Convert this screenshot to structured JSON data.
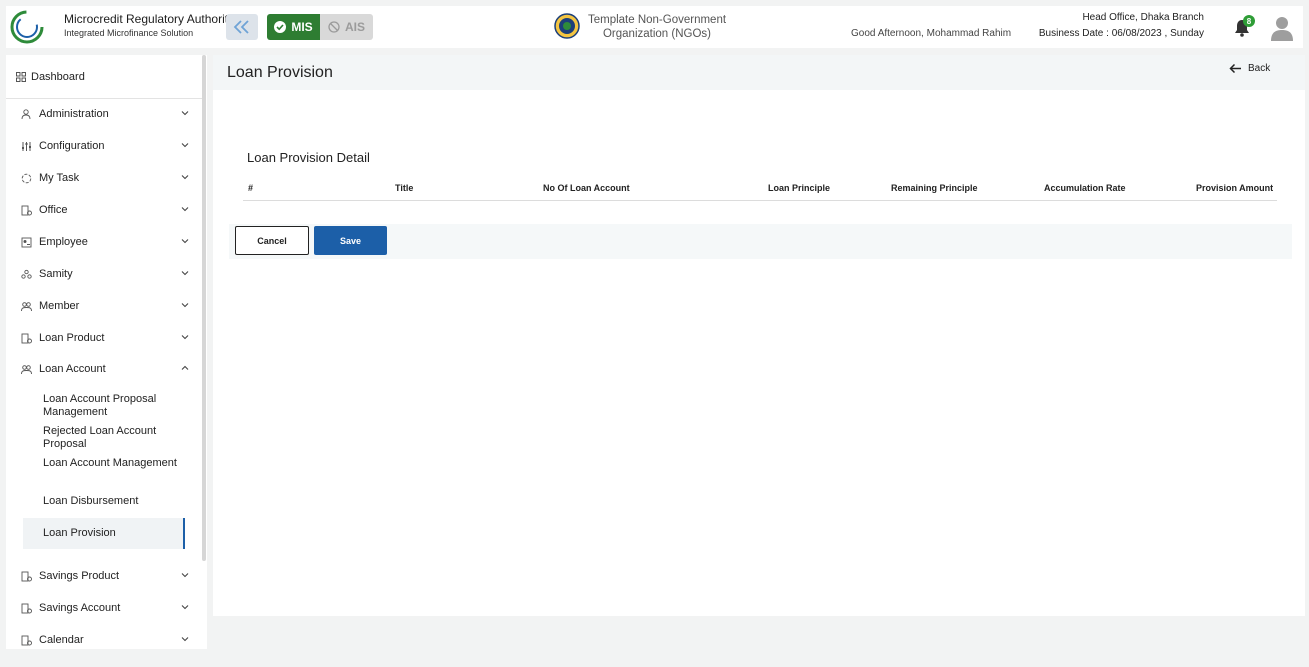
{
  "header": {
    "org_title": "Microcredit Regulatory Authority",
    "org_subtitle": "Integrated Microfinance Solution",
    "logo_text": "Microcredit Regulatory Authority",
    "mode_mis": "MIS",
    "mode_ais": "AIS",
    "ngo_line1": "Template Non-Government",
    "ngo_line2": "Organization (NGOs)",
    "greeting": "Good Afternoon, Mohammad Rahim",
    "branch": "Head Office, Dhaka Branch",
    "business_date": "Business Date : 06/08/2023 , Sunday",
    "notification_count": "8",
    "colors": {
      "brand_green": "#2e7d32",
      "primary_blue": "#1c5fa8"
    }
  },
  "sidebar": {
    "dashboard": "Dashboard",
    "items": [
      {
        "label": "Administration",
        "icon": "admin-icon"
      },
      {
        "label": "Configuration",
        "icon": "sliders-icon"
      },
      {
        "label": "My Task",
        "icon": "task-icon"
      },
      {
        "label": "Office",
        "icon": "office-icon"
      },
      {
        "label": "Employee",
        "icon": "employee-icon"
      },
      {
        "label": "Samity",
        "icon": "samity-icon"
      },
      {
        "label": "Member",
        "icon": "member-icon"
      },
      {
        "label": "Loan Product",
        "icon": "product-icon"
      },
      {
        "label": "Loan Account",
        "icon": "account-icon"
      },
      {
        "label": "Savings Product",
        "icon": "product-icon"
      },
      {
        "label": "Savings Account",
        "icon": "account-icon"
      },
      {
        "label": "Calendar",
        "icon": "calendar-icon"
      }
    ],
    "loan_account_sub": [
      "Loan Account Proposal Management",
      "Rejected Loan Account Proposal",
      "Loan Account Management",
      "Loan Disbursement",
      "Loan Provision"
    ]
  },
  "main": {
    "page_title": "Loan Provision",
    "back_label": "Back",
    "section_title": "Loan Provision Detail",
    "columns": [
      "#",
      "Title",
      "No Of Loan Account",
      "Loan Principle",
      "Remaining Principle",
      "Accumulation Rate",
      "Provision Amount"
    ],
    "cancel_label": "Cancel",
    "save_label": "Save"
  }
}
